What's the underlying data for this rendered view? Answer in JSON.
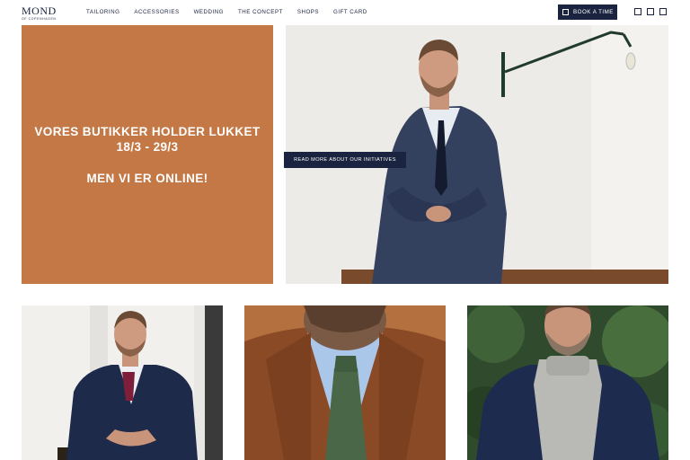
{
  "header": {
    "logo": "MOND",
    "logo_sub": "OF COPENHAGEN",
    "nav": [
      "TAILORING",
      "ACCESSORIES",
      "WEDDING",
      "THE CONCEPT",
      "SHOPS",
      "GIFT CARD"
    ],
    "book_label": "BOOK A TIME",
    "icons": [
      "search-icon",
      "account-icon",
      "cart-icon"
    ]
  },
  "promo": {
    "line1": "VORES BUTIKKER HOLDER LUKKET",
    "line2": "18/3 - 29/3",
    "line3": "MEN VI ER ONLINE!",
    "bg_color": "#c37846"
  },
  "hero": {
    "read_more": "READ MORE ABOUT OUR INITIATIVES"
  },
  "colors": {
    "navy": "#1a2440",
    "accent": "#c37846"
  }
}
